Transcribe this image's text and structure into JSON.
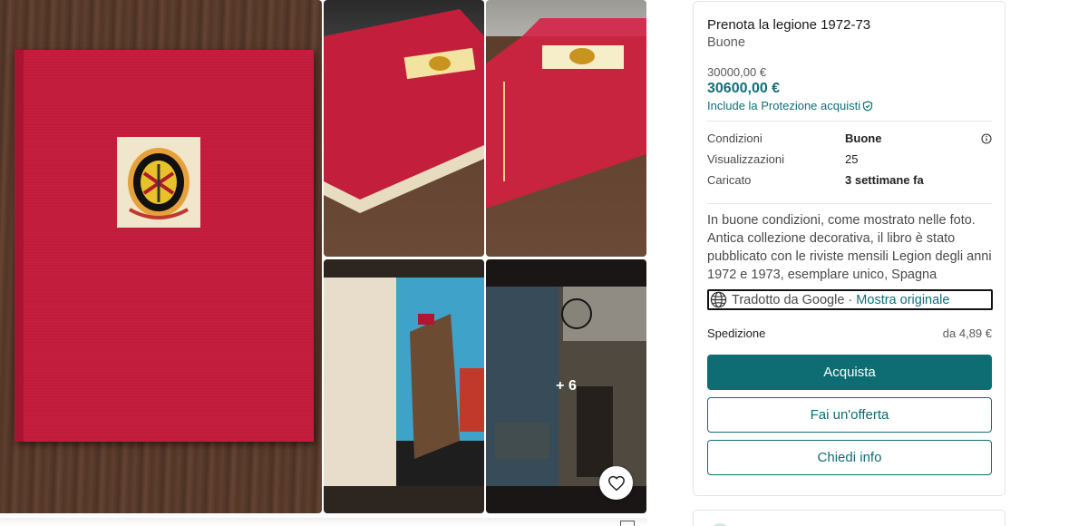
{
  "gallery": {
    "more_photos_label": "+ 6",
    "favourite_icon": "heart-icon"
  },
  "listing": {
    "title": "Prenota la legione 1972-73",
    "condition_summary": "Buone",
    "original_price": "30000,00 €",
    "total_price": "30600,00 €",
    "buyer_protection": "Include la Protezione acquisti",
    "details": [
      {
        "label": "Condizioni",
        "value": "Buone"
      },
      {
        "label": "Visualizzazioni",
        "value": "25"
      },
      {
        "label": "Caricato",
        "value": "3 settimane fa"
      }
    ],
    "description": "In buone condizioni, come mostrato nelle foto. Antica collezione decorativa, il libro è stato pubblicato con le riviste mensili Legion degli anni 1972 e 1973, esemplare unico, Spagna",
    "translated_by": "Tradotto da Google",
    "separator": " · ",
    "show_original": "Mostra originale",
    "shipping_label": "Spedizione",
    "shipping_value": "da 4,89 €"
  },
  "actions": {
    "buy": "Acquista",
    "offer": "Fai un'offerta",
    "ask": "Chiedi info"
  },
  "colors": {
    "accent": "#0e6c73",
    "book_red": "#c81e3f"
  }
}
